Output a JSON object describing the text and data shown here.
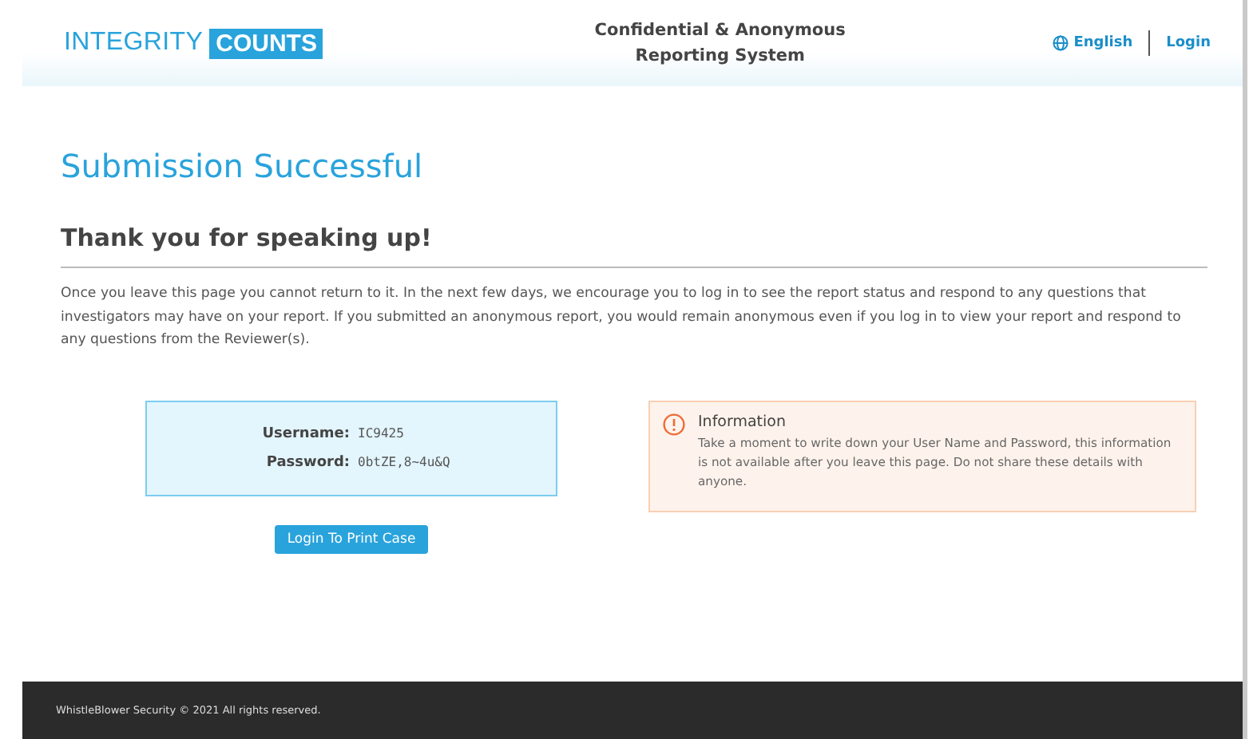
{
  "header": {
    "logo": {
      "light": "INTEGRITY",
      "bold": "COUNTS"
    },
    "title": "Confidential & Anonymous Reporting System",
    "language": "English",
    "login": "Login"
  },
  "heading": "Submission Successful",
  "subheading": "Thank you for speaking up!",
  "message": "Once you leave this page you cannot return to it. In the next few days, we encourage you to log in to see the report status and respond to any questions that investigators may have on your report. If you submitted an anonymous report, you would remain anonymous even if you log in to view your report and respond to any questions from the Reviewer(s).",
  "credentials": [
    {
      "label": "Username:",
      "value": "IC9425"
    },
    {
      "label": "Password:",
      "value": "0btZE,8~4u&Q"
    }
  ],
  "print_button": "Login To Print Case",
  "info": {
    "title": "Information",
    "text": "Take a moment to write down your User Name and Password, this information is not available after you leave this page. Do not share these details with anyone."
  },
  "footer": "WhistleBlower Security © 2021 All rights reserved."
}
